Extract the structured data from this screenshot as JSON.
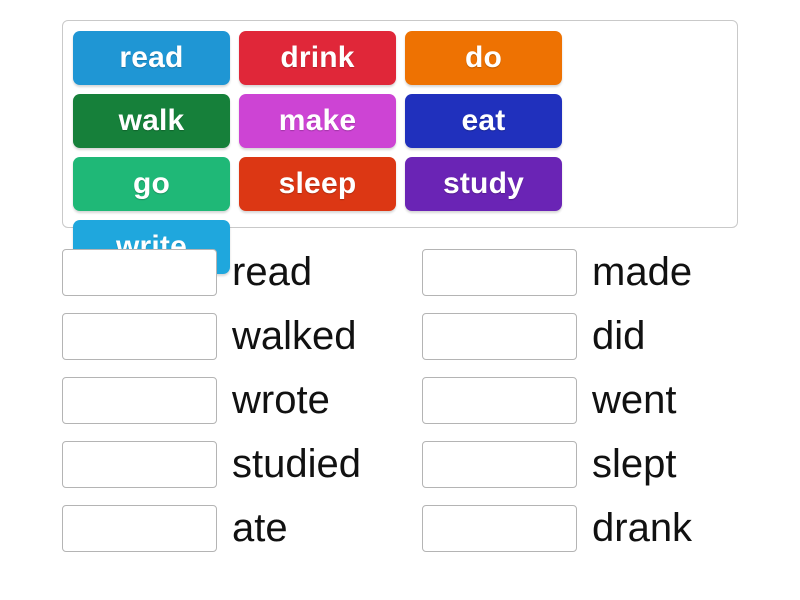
{
  "word_bank": {
    "tiles": [
      {
        "label": "read",
        "color": "#1f96d4"
      },
      {
        "label": "drink",
        "color": "#e02739"
      },
      {
        "label": "do",
        "color": "#ee7202"
      },
      {
        "label": "walk",
        "color": "#16803a"
      },
      {
        "label": "make",
        "color": "#cd44d4"
      },
      {
        "label": "eat",
        "color": "#2030bd"
      },
      {
        "label": "go",
        "color": "#1fb877"
      },
      {
        "label": "sleep",
        "color": "#dc3714"
      },
      {
        "label": "study",
        "color": "#6a24b5"
      },
      {
        "label": "write",
        "color": "#1fa7dd"
      }
    ]
  },
  "answers": {
    "left_column": [
      {
        "slot_value": "",
        "label": "read"
      },
      {
        "slot_value": "",
        "label": "walked"
      },
      {
        "slot_value": "",
        "label": "wrote"
      },
      {
        "slot_value": "",
        "label": "studied"
      },
      {
        "slot_value": "",
        "label": "ate"
      }
    ],
    "right_column": [
      {
        "slot_value": "",
        "label": "made"
      },
      {
        "slot_value": "",
        "label": "did"
      },
      {
        "slot_value": "",
        "label": "went"
      },
      {
        "slot_value": "",
        "label": "slept"
      },
      {
        "slot_value": "",
        "label": "drank"
      }
    ]
  }
}
